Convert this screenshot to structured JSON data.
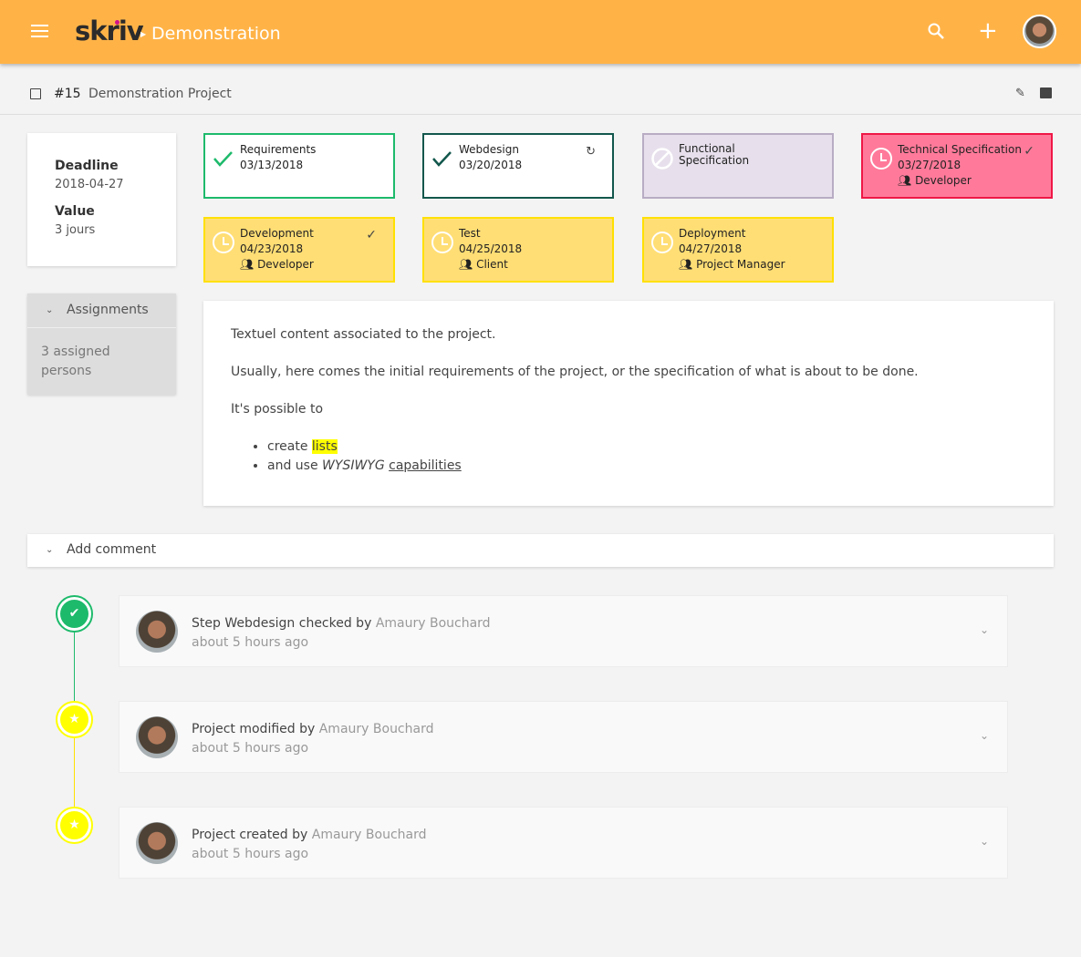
{
  "header": {
    "logo": "skriv",
    "breadcrumb": "Demonstration",
    "color": "#ffb347"
  },
  "project": {
    "number": "#15",
    "title": "Demonstration Project"
  },
  "info": {
    "deadline_label": "Deadline",
    "deadline": "2018-04-27",
    "value_label": "Value",
    "value": "3 jours"
  },
  "assignments": {
    "title": "Assignments",
    "summary": "3 assigned persons"
  },
  "steps": [
    {
      "name": "Requirements",
      "date": "03/13/2018",
      "role": "",
      "state": "done"
    },
    {
      "name": "Webdesign",
      "date": "03/20/2018",
      "role": "",
      "state": "done"
    },
    {
      "name": "Functional Specification",
      "date": "",
      "role": "",
      "state": "disabled"
    },
    {
      "name": "Technical Specification",
      "date": "03/27/2018",
      "role": "Developer",
      "state": "late"
    },
    {
      "name": "Development",
      "date": "04/23/2018",
      "role": "Developer",
      "state": "pending"
    },
    {
      "name": "Test",
      "date": "04/25/2018",
      "role": "Client",
      "state": "pending"
    },
    {
      "name": "Deployment",
      "date": "04/27/2018",
      "role": "Project Manager",
      "state": "pending"
    }
  ],
  "content": {
    "p1": "Textuel content associated to the project.",
    "p2": "Usually, here comes the initial requirements of the project, or the specification of what is about to be done.",
    "p3": "It's possible to",
    "li1_a": "create ",
    "li1_b": "lists",
    "li2_a": "and use ",
    "li2_b": "WYSIWYG",
    "li2_c": "capabilities"
  },
  "add_comment": "Add comment",
  "timeline": [
    {
      "action": "Step Webdesign checked by ",
      "user": "Amaury Bouchard",
      "time": "about 5 hours ago",
      "icon": "shield-check"
    },
    {
      "action": "Project modified by ",
      "user": "Amaury Bouchard",
      "time": "about 5 hours ago",
      "icon": "star"
    },
    {
      "action": "Project created by ",
      "user": "Amaury Bouchard",
      "time": "about 5 hours ago",
      "icon": "star"
    }
  ]
}
